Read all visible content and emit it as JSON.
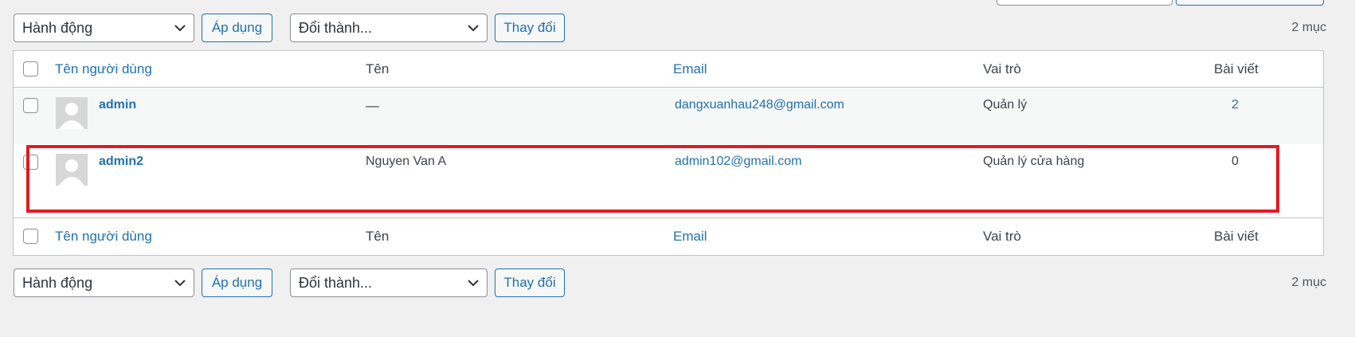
{
  "top_bar": {
    "bulk_action": "Hành động",
    "apply_label": "Áp dụng",
    "change_role": "Đổi thành...",
    "change_label": "Thay đổi",
    "count": "2 mục"
  },
  "bottom_bar": {
    "bulk_action": "Hành động",
    "apply_label": "Áp dụng",
    "change_role": "Đổi thành...",
    "change_label": "Thay đổi",
    "count": "2 mục"
  },
  "table": {
    "columns": {
      "username": "Tên người dùng",
      "name": "Tên",
      "email": "Email",
      "role": "Vai trò",
      "posts": "Bài viết"
    },
    "rows": [
      {
        "username": "admin",
        "name": "—",
        "email": "dangxuanhau248@gmail.com",
        "role": "Quản lý",
        "posts": "2"
      },
      {
        "username": "admin2",
        "name": "Nguyen Van A",
        "email": "admin102@gmail.com",
        "role": "Quản lý cửa hàng",
        "posts": "0"
      }
    ]
  },
  "colors": {
    "accent": "#2271b1",
    "highlight_box": "#e21a22",
    "background": "#f0f0f1"
  }
}
